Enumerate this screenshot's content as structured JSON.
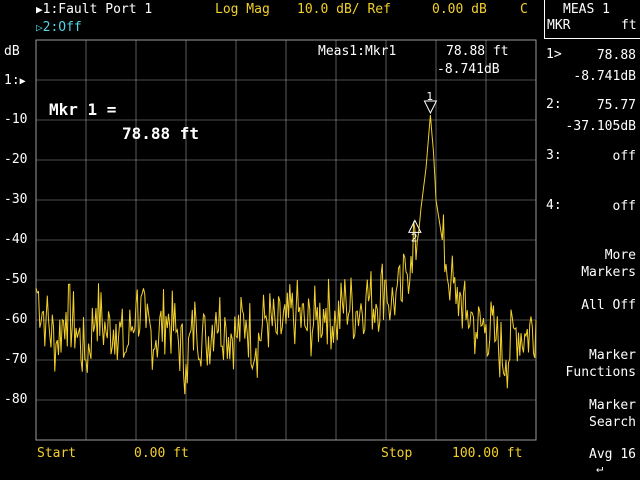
{
  "header": {
    "trace1": "1:Fault Port 1",
    "format": "Log Mag",
    "scale": "10.0 dB/ Ref",
    "ref": "0.00 dB",
    "flag": "C",
    "trace2": "2:Off"
  },
  "plot": {
    "yunit": "dB",
    "ref_label": "1:",
    "ylabels": [
      "-10",
      "-20",
      "-30",
      "-40",
      "-50",
      "-60",
      "-70",
      "-80"
    ],
    "meas_label": "Meas1:Mkr1",
    "meas_x": "78.88 ft",
    "meas_y": "-8.741dB",
    "mkr_big_label": "Mkr 1 =",
    "mkr_big_value": "78.88 ft",
    "marker1_num": "1",
    "marker2_num": "2",
    "start_label": "Start",
    "start_value": "0.00 ft",
    "stop_label": "Stop",
    "stop_value": "100.00 ft"
  },
  "softkeys": {
    "title": "MEAS 1",
    "title_sub": "MKR",
    "title_unit": "ft",
    "m1_label": "1>",
    "m1_x": "78.88",
    "m1_y": "-8.741dB",
    "m2_label": "2:",
    "m2_x": "75.77",
    "m2_y": "-37.105dB",
    "m3_label": "3:",
    "m3_val": "off",
    "m4_label": "4:",
    "m4_val": "off",
    "more1": "More",
    "more2": "Markers",
    "alloff": "All Off",
    "mf1": "Marker",
    "mf2": "Functions",
    "ms1": "Marker",
    "ms2": "Search",
    "avg": "Avg 16"
  },
  "colors": {
    "trace": "#f2d02b",
    "grid": "#9a9a9a",
    "trace2": "#53d5e6"
  },
  "chart_data": {
    "type": "line",
    "xlim": [
      0,
      100
    ],
    "ylim": [
      -90,
      10
    ],
    "series": [
      {
        "name": "1:Fault Port 1",
        "x": [
          0,
          2,
          4,
          6,
          8,
          10,
          12,
          14,
          16,
          18,
          20,
          22,
          24,
          26,
          28,
          30,
          32,
          34,
          36,
          38,
          40,
          42,
          44,
          46,
          48,
          50,
          52,
          54,
          56,
          58,
          60,
          62,
          64,
          66,
          68,
          70,
          71,
          72,
          73,
          74,
          75,
          75.77,
          76,
          77,
          78,
          78.88,
          79.5,
          80,
          81,
          82,
          83,
          84,
          85,
          86,
          87,
          88,
          90,
          92,
          94,
          96,
          98,
          100
        ],
        "values": [
          -52,
          -60,
          -66,
          -58,
          -62,
          -70,
          -57,
          -63,
          -61,
          -68,
          -56,
          -62,
          -65,
          -59,
          -63,
          -71,
          -60,
          -66,
          -58,
          -62,
          -64,
          -60,
          -67,
          -59,
          -63,
          -61,
          -58,
          -62,
          -60,
          -57,
          -61,
          -55,
          -58,
          -54,
          -56,
          -50,
          -57,
          -53,
          -55,
          -48,
          -44,
          -37.1,
          -45,
          -32,
          -22,
          -8.741,
          -18,
          -30,
          -38,
          -46,
          -50,
          -56,
          -54,
          -60,
          -58,
          -63,
          -61,
          -65,
          -70,
          -62,
          -64,
          -60
        ]
      }
    ],
    "markers": [
      {
        "num": "1",
        "x": 78.88,
        "y": -8.741
      },
      {
        "num": "2",
        "x": 75.77,
        "y": -37.105
      }
    ]
  }
}
